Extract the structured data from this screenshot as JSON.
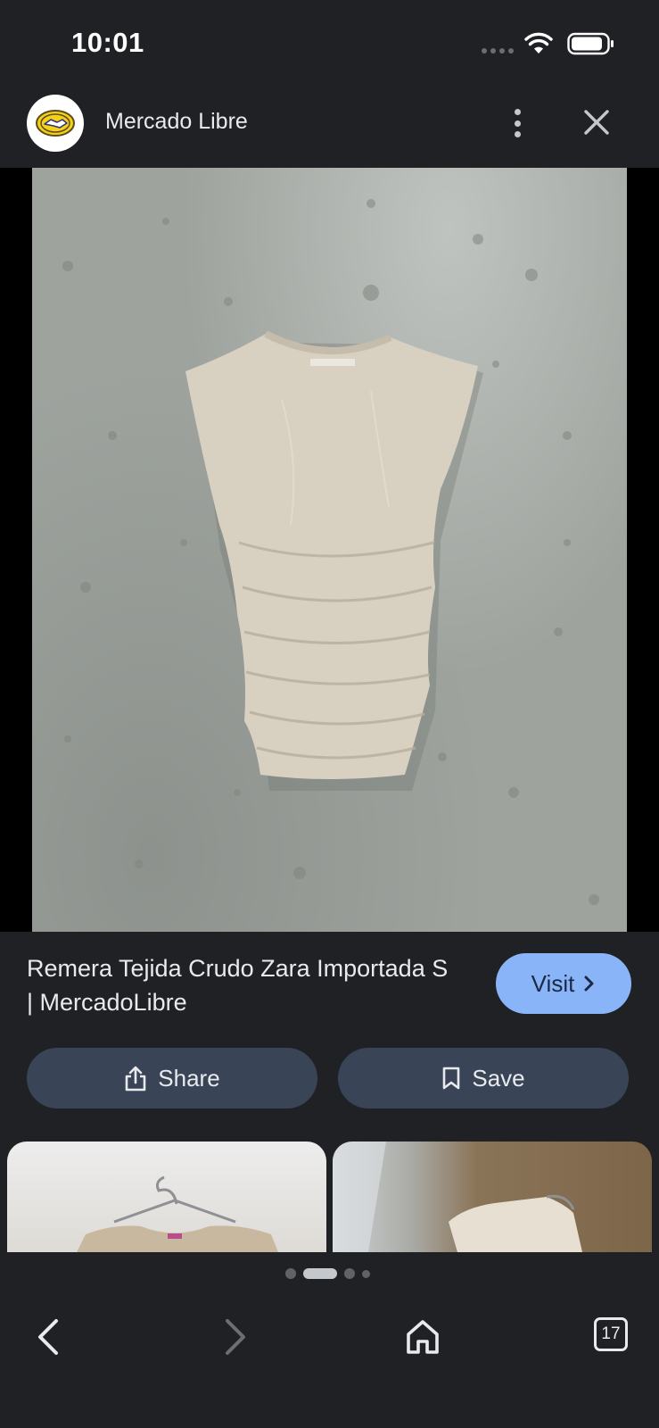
{
  "status_bar": {
    "time": "10:01"
  },
  "header": {
    "site_name": "Mercado Libre",
    "logo_icon": "mercadolibre-handshake-logo",
    "menu_icon": "more-vert-icon",
    "close_icon": "close-icon"
  },
  "result": {
    "title": "Remera Tejida Crudo Zara Importada S | MercadoLibre",
    "visit_label": "Visit",
    "share_label": "Share",
    "save_label": "Save"
  },
  "pager": {
    "active_index": 1,
    "count": 4
  },
  "bottom_nav": {
    "tab_count": "17"
  },
  "colors": {
    "background": "#202125",
    "accent": "#8ab4f8",
    "pill": "#394457"
  }
}
